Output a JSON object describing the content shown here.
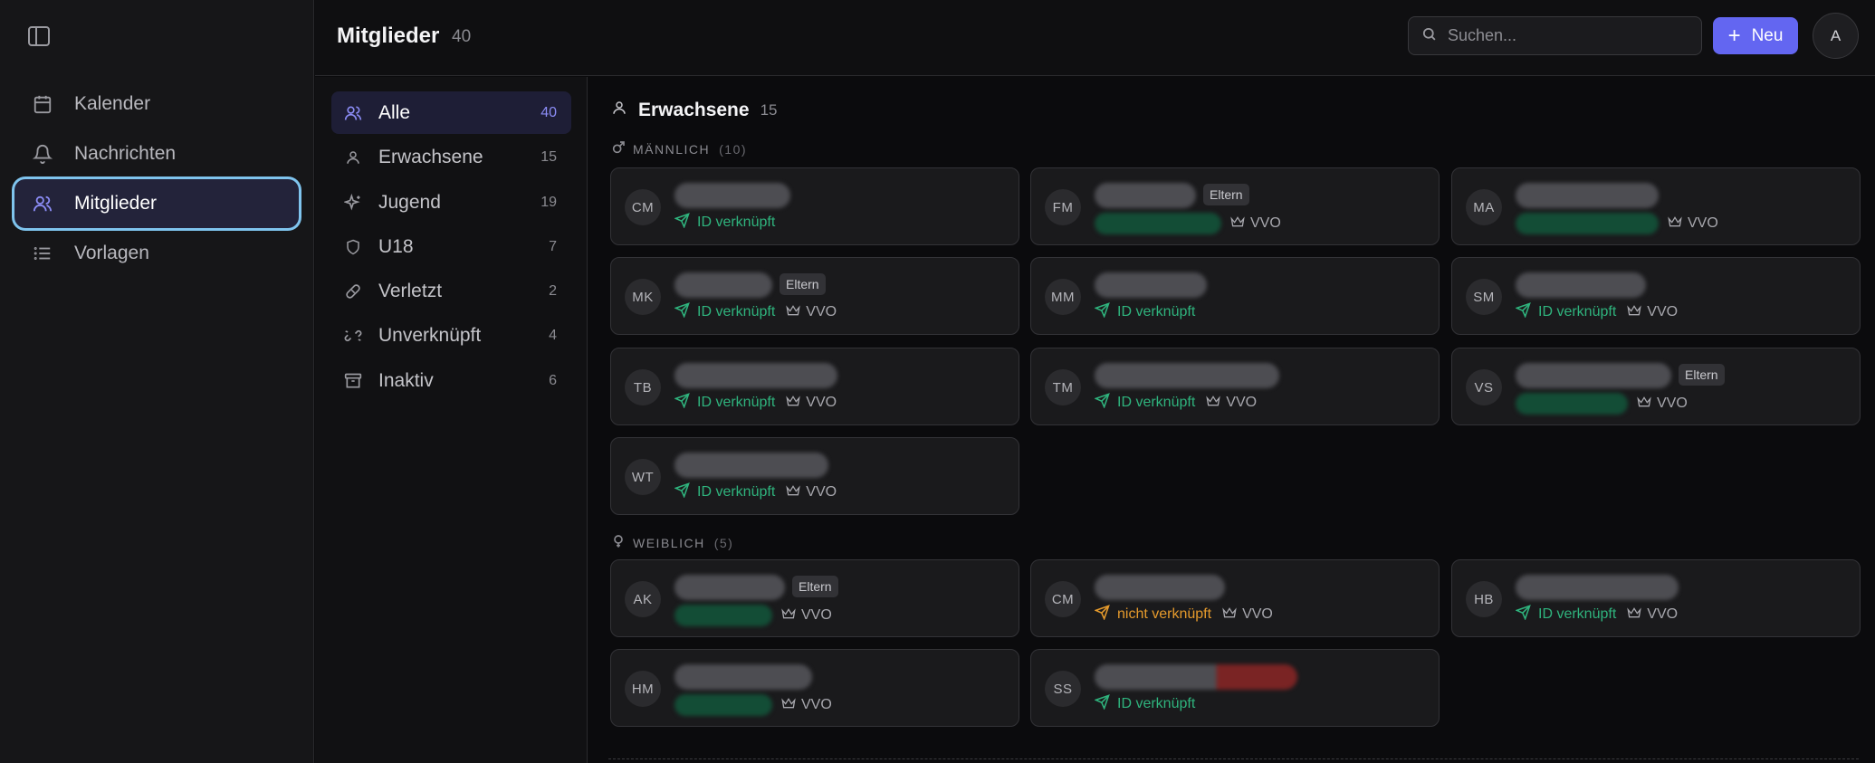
{
  "sidebar": {
    "items": [
      {
        "label": "Kalender",
        "icon": "calendar-icon"
      },
      {
        "label": "Nachrichten",
        "icon": "bell-icon"
      },
      {
        "label": "Mitglieder",
        "icon": "users-icon",
        "active": true
      },
      {
        "label": "Vorlagen",
        "icon": "list-icon"
      }
    ]
  },
  "header": {
    "title": "Mitglieder",
    "count": "40",
    "search_placeholder": "Suchen...",
    "new_label": "Neu",
    "avatar": "A"
  },
  "filters": [
    {
      "label": "Alle",
      "count": "40",
      "icon": "users-icon",
      "active": true
    },
    {
      "label": "Erwachsene",
      "count": "15",
      "icon": "user-icon"
    },
    {
      "label": "Jugend",
      "count": "19",
      "icon": "sparkles-icon"
    },
    {
      "label": "U18",
      "count": "7",
      "icon": "shield-icon"
    },
    {
      "label": "Verletzt",
      "count": "2",
      "icon": "bandage-icon"
    },
    {
      "label": "Unverknüpft",
      "count": "4",
      "icon": "unlink-icon"
    },
    {
      "label": "Inaktiv",
      "count": "6",
      "icon": "archive-icon"
    }
  ],
  "section": {
    "title": "Erwachsene",
    "count": "15"
  },
  "groups": [
    {
      "label": "MÄNNLICH",
      "count": "(10)"
    },
    {
      "label": "WEIBLICH",
      "count": "(5)"
    }
  ],
  "labels": {
    "linked": "ID verknüpft",
    "unlinked": "nicht verknüpft",
    "vvo": "VVO",
    "eltern": "Eltern"
  },
  "cards": [
    {
      "initials": "CM"
    },
    {
      "initials": "FM"
    },
    {
      "initials": "MA"
    },
    {
      "initials": "MK"
    },
    {
      "initials": "MM"
    },
    {
      "initials": "SM"
    },
    {
      "initials": "TB"
    },
    {
      "initials": "TM"
    },
    {
      "initials": "VS"
    },
    {
      "initials": "WT"
    },
    {
      "initials": "AK"
    },
    {
      "initials": "CM"
    },
    {
      "initials": "HB"
    },
    {
      "initials": "HM"
    },
    {
      "initials": "SS"
    }
  ],
  "colors": {
    "accent": "#6366f1",
    "linked": "#2fb37d",
    "unlinked": "#e59a2c"
  }
}
